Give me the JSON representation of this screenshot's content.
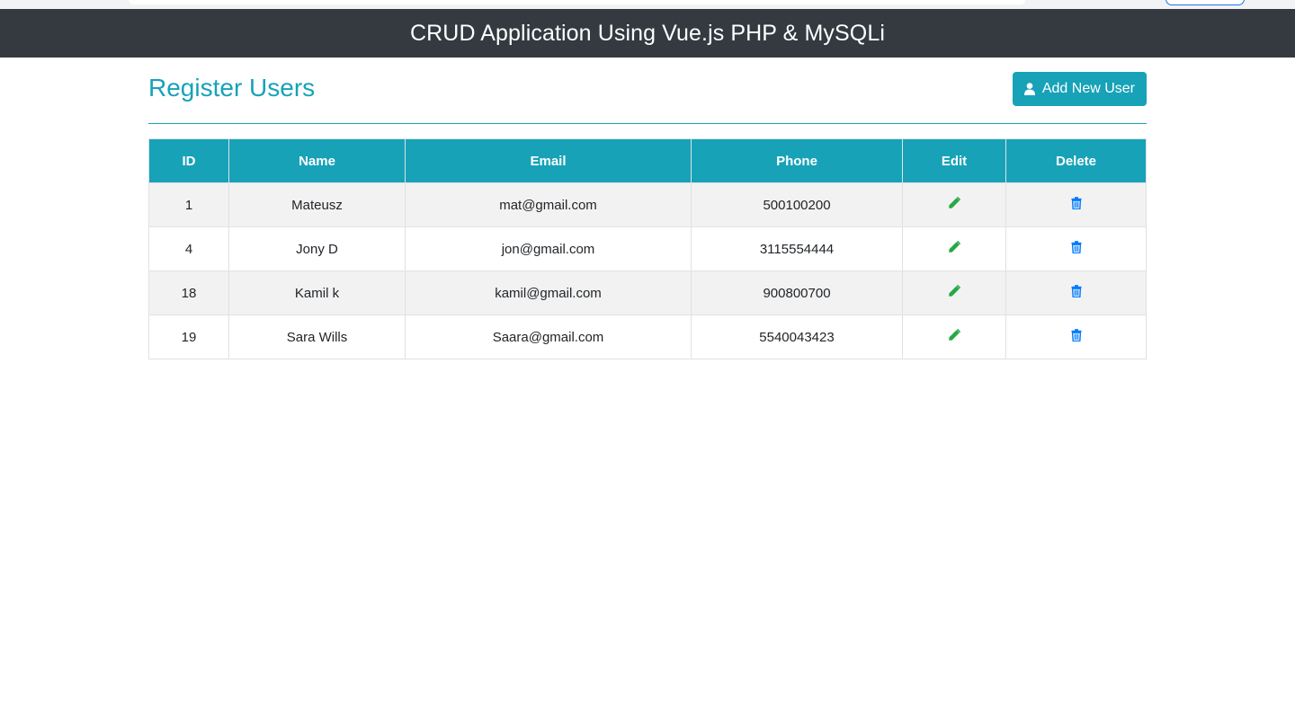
{
  "navbar": {
    "title": "CRUD Application Using Vue.js PHP & MySQLi"
  },
  "page": {
    "title": "Register Users",
    "add_button_label": "Add New User",
    "add_button_icon": "user-icon"
  },
  "colors": {
    "accent": "#17a2b8",
    "navbar": "#343a40",
    "edit_icon": "#28a745",
    "delete_icon": "#007bff",
    "row_stripe": "#f2f2f2"
  },
  "table": {
    "headers": {
      "id": "ID",
      "name": "Name",
      "email": "Email",
      "phone": "Phone",
      "edit": "Edit",
      "delete": "Delete"
    },
    "rows": [
      {
        "id": "1",
        "name": "Mateusz",
        "email": "mat@gmail.com",
        "phone": "500100200"
      },
      {
        "id": "4",
        "name": "Jony D",
        "email": "jon@gmail.com",
        "phone": "3115554444"
      },
      {
        "id": "18",
        "name": "Kamil k",
        "email": "kamil@gmail.com",
        "phone": "900800700"
      },
      {
        "id": "19",
        "name": "Sara Wills",
        "email": "Saara@gmail.com",
        "phone": "5540043423"
      }
    ],
    "edit_icon": "pencil-icon",
    "delete_icon": "trash-icon"
  }
}
